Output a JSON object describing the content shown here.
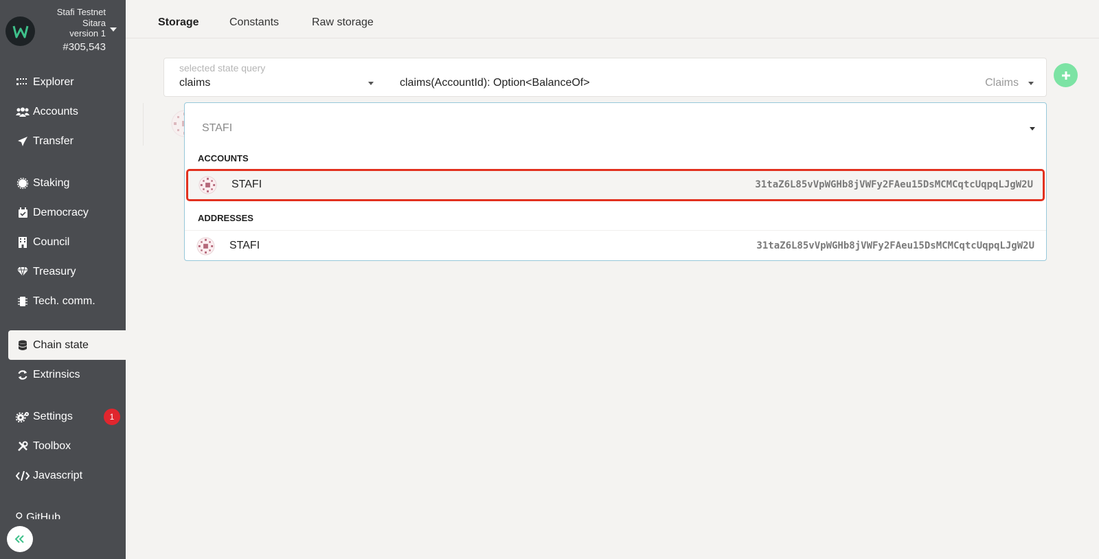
{
  "chain": {
    "name": "Stafi Testnet",
    "spec_line1": "Sitara",
    "spec_line2": "version 1",
    "block": "#305,543"
  },
  "sidebar": {
    "items": [
      {
        "label": "Explorer",
        "icon": "grid-dots-icon"
      },
      {
        "label": "Accounts",
        "icon": "users-icon"
      },
      {
        "label": "Transfer",
        "icon": "paper-plane-icon"
      },
      {
        "label": "Staking",
        "icon": "certificate-icon"
      },
      {
        "label": "Democracy",
        "icon": "calendar-check-icon"
      },
      {
        "label": "Council",
        "icon": "building-icon"
      },
      {
        "label": "Treasury",
        "icon": "gem-icon"
      },
      {
        "label": "Tech. comm.",
        "icon": "microchip-icon"
      },
      {
        "label": "Chain state",
        "icon": "database-icon"
      },
      {
        "label": "Extrinsics",
        "icon": "sync-icon"
      },
      {
        "label": "Settings",
        "icon": "cogs-icon",
        "badge": "1"
      },
      {
        "label": "Toolbox",
        "icon": "tools-icon"
      },
      {
        "label": "Javascript",
        "icon": "code-icon"
      },
      {
        "label": "GitHub",
        "icon": "github-icon"
      }
    ],
    "active": "Chain state"
  },
  "tabs": [
    "Storage",
    "Constants",
    "Raw storage"
  ],
  "active_tab": "Storage",
  "query": {
    "label": "selected state query",
    "value": "claims",
    "signature": "claims(AccountId): Option<BalanceOf>",
    "section": "Claims"
  },
  "dropdown": {
    "input_value": "STAFI",
    "accounts_header": "ACCOUNTS",
    "addresses_header": "ADDRESSES",
    "accounts": [
      {
        "name": "STAFI",
        "address": "31taZ6L85vVpWGHb8jVWFy2FAeu15DsMCMCqtcUqpqLJgW2U"
      }
    ],
    "addresses": [
      {
        "name": "STAFI",
        "address": "31taZ6L85vVpWGHb8jVWFy2FAeu15DsMCMCqtcUqpqLJgW2U"
      }
    ]
  },
  "colors": {
    "sidebar_bg": "#4a4c50",
    "accent_green": "#7ce3a4",
    "highlight_red": "#e2311f",
    "badge_red": "#e0262e"
  }
}
